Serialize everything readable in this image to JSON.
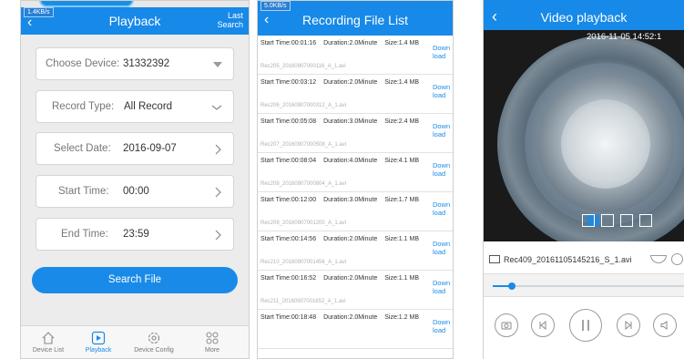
{
  "colors": {
    "accent": "#1a8ae8",
    "background": "#ececec"
  },
  "playback": {
    "status_speed": "1.4KB/s",
    "title": "Playback",
    "last_search": [
      "Last",
      "Search"
    ],
    "fields": [
      {
        "label": "Choose Device:",
        "value": "31332392",
        "control": "dropdown-triangle"
      },
      {
        "label": "Record Type:",
        "value": "All Record",
        "control": "chevron-down-icon"
      },
      {
        "label": "Select Date:",
        "value": "2016-09-07",
        "control": "chevron-right-icon"
      },
      {
        "label": "Start Time:",
        "value": "00:00",
        "control": "chevron-right-icon"
      },
      {
        "label": "End Time:",
        "value": "23:59",
        "control": "chevron-right-icon"
      }
    ],
    "search_button": "Search File",
    "tabs": [
      {
        "label": "Device List",
        "icon": "home-icon"
      },
      {
        "label": "Playback",
        "icon": "play-icon",
        "active": true
      },
      {
        "label": "Device Config",
        "icon": "gear-icon"
      },
      {
        "label": "More",
        "icon": "more-icon"
      }
    ]
  },
  "file_list": {
    "status_speed": "5.0KB/s",
    "title": "Recording File List",
    "download_label": [
      "Down",
      "load"
    ],
    "records": [
      {
        "start": "Start Time:00:01:16",
        "duration": "Duration:2.0Minute",
        "size": "Size:1.4 MB",
        "file": "Rec205_20160907000116_A_1.avi"
      },
      {
        "start": "Start Time:00:03:12",
        "duration": "Duration:2.0Minute",
        "size": "Size:1.4 MB",
        "file": "Rec206_20160907000312_A_1.avi"
      },
      {
        "start": "Start Time:00:05:08",
        "duration": "Duration:3.0Minute",
        "size": "Size:2.4 MB",
        "file": "Rec207_20160907000508_A_1.avi"
      },
      {
        "start": "Start Time:00:08:04",
        "duration": "Duration:4.0Minute",
        "size": "Size:4.1 MB",
        "file": "Rec208_20160907000804_A_1.avi"
      },
      {
        "start": "Start Time:00:12:00",
        "duration": "Duration:3.0Minute",
        "size": "Size:1.7 MB",
        "file": "Rec209_20160907001200_A_1.avi"
      },
      {
        "start": "Start Time:00:14:56",
        "duration": "Duration:2.0Minute",
        "size": "Size:1.1 MB",
        "file": "Rec210_20160907001456_A_1.avi"
      },
      {
        "start": "Start Time:00:16:52",
        "duration": "Duration:2.0Minute",
        "size": "Size:1.1 MB",
        "file": "Rec211_20160907001652_A_1.avi"
      },
      {
        "start": "Start Time:00:18:48",
        "duration": "Duration:2.0Minute",
        "size": "Size:1.2 MB",
        "file": ""
      }
    ]
  },
  "video": {
    "title": "Video playback",
    "timestamp": "2016-11-05 14:52:1",
    "file_name": "Rec409_20161105145216_S_1.avi",
    "progress_fraction": 0.1
  }
}
